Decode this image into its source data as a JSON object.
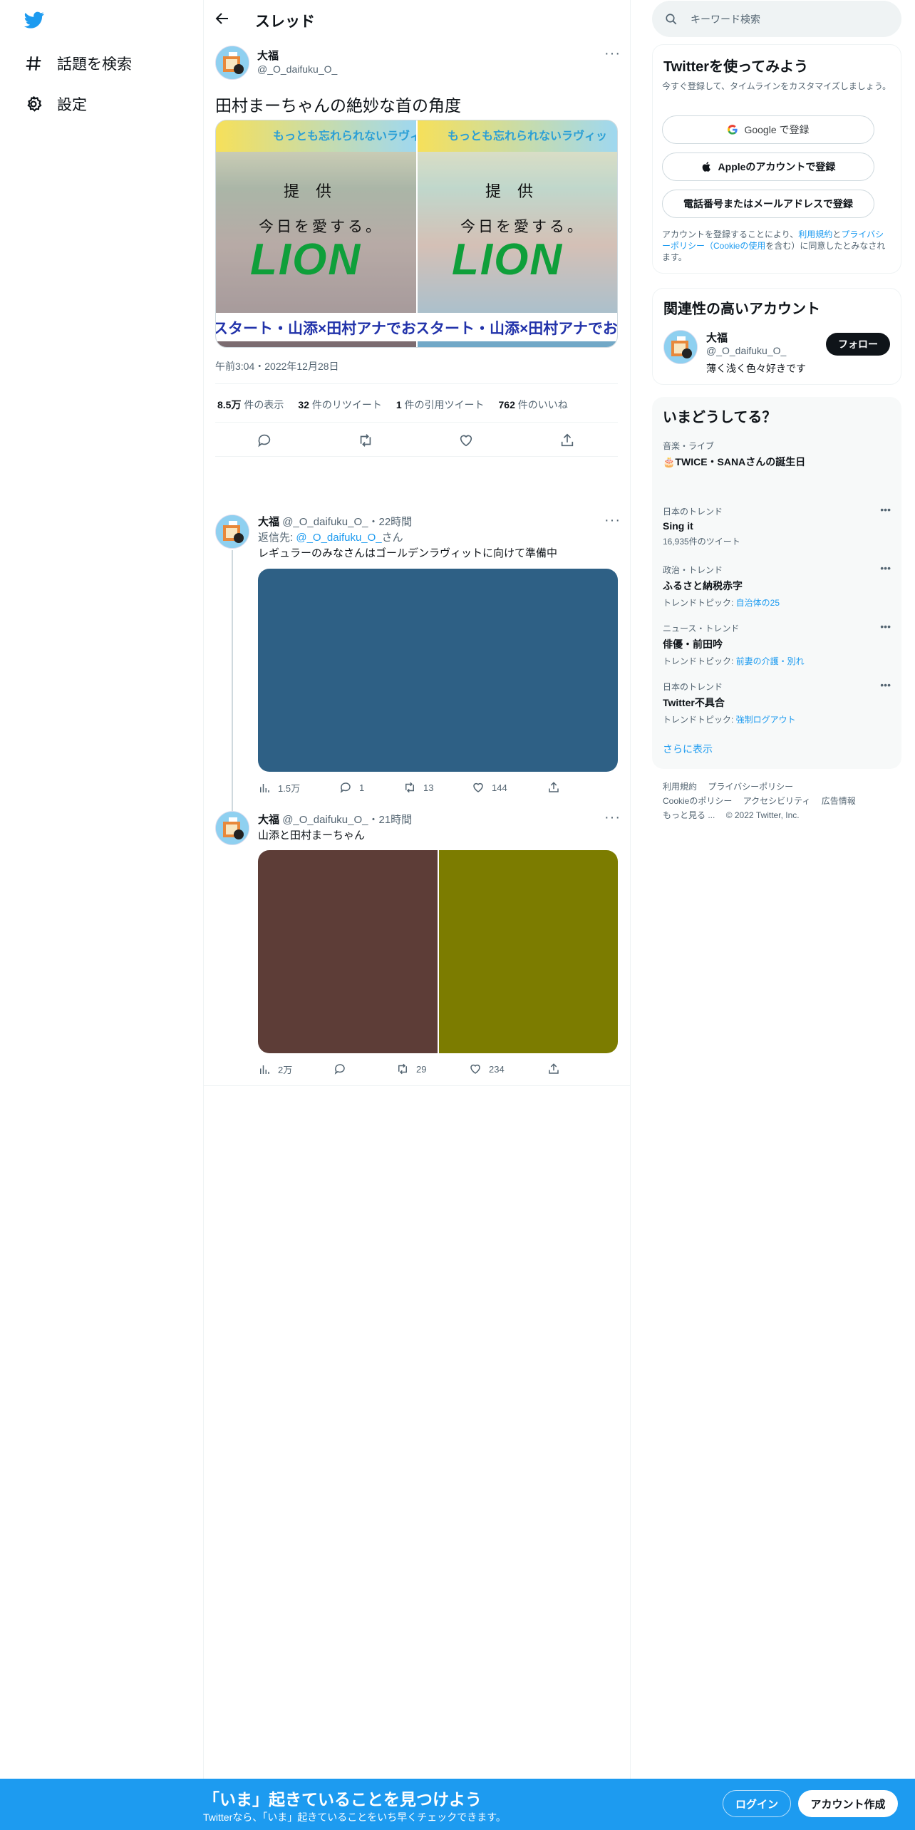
{
  "nav": {
    "explore_label": "話題を検索",
    "settings_label": "設定"
  },
  "header": {
    "title": "スレッド"
  },
  "main_tweet": {
    "author_name": "大福",
    "author_handle": "@_O_daifuku_O_",
    "text": "田村まーちゃんの絶妙な首の角度",
    "image_left": {
      "banner": "もっとも忘れられないラヴィッ",
      "sponsor_label": "提 供",
      "slogan": "今日を愛する。",
      "logo": "LION",
      "caption": "スタート・山添×田村アナでお"
    },
    "image_right": {
      "banner": "もっとも忘れられないラヴィッ",
      "sponsor_label": "提 供",
      "slogan": "今日を愛する。",
      "logo": "LION",
      "caption": "スタート・山添×田村アナでお"
    },
    "timestamp": "午前3:04・2022年12月28日",
    "stats": {
      "views_num": "8.5万",
      "views_label": "件の表示",
      "retweets_num": "32",
      "retweets_label": "件のリツイート",
      "quotes_num": "1",
      "quotes_label": "件の引用ツイート",
      "likes_num": "762",
      "likes_label": "件のいいね"
    }
  },
  "replies": [
    {
      "author_name": "大福",
      "author_meta": "@_O_daifuku_O_・22時間",
      "reply_to_prefix": "返信先: ",
      "reply_to_handle": "@_O_daifuku_O_",
      "reply_to_suffix": "さん",
      "text": "レギュラーのみなさんはゴールデンラヴィットに向けて準備中",
      "media_colors": [
        "#2e6085"
      ],
      "views": "1.5万",
      "replies": "1",
      "retweets": "13",
      "likes": "144"
    },
    {
      "author_name": "大福",
      "author_meta": "@_O_daifuku_O_・21時間",
      "text": "山添と田村まーちゃん",
      "media_colors": [
        "#5d3d37",
        "#7c7c00"
      ],
      "views": "2万",
      "replies": "",
      "retweets": "29",
      "likes": "234"
    }
  ],
  "search": {
    "placeholder": "キーワード検索"
  },
  "signup": {
    "title": "Twitterを使ってみよう",
    "subtitle": "今すぐ登録して、タイムラインをカスタマイズしましょう。",
    "google_label": "Google で登録",
    "apple_label": "Appleのアカウントで登録",
    "phone_label": "電話番号またはメールアドレスで登録",
    "terms_prefix": "アカウントを登録することにより、",
    "terms_link": "利用規約",
    "terms_and": "と",
    "privacy_link": "プライバシーポリシー（Cookieの使用",
    "terms_suffix": "を含む）に同意したとみなされます。"
  },
  "related": {
    "title": "関連性の高いアカウント",
    "name": "大福",
    "handle": "@_O_daifuku_O_",
    "bio": "薄く浅く色々好きです",
    "follow_label": "フォロー"
  },
  "trends": {
    "title": "いまどうしてる？",
    "music_category": "音楽・ライブ",
    "music_name": "🎂TWICE・SANAさんの誕生日",
    "items": [
      {
        "category": "日本のトレンド",
        "name": "Sing it",
        "sub": "16,935件のツイート",
        "sub_prefix": "",
        "sub_link": ""
      },
      {
        "category": "政治・トレンド",
        "name": "ふるさと納税赤字",
        "sub": "",
        "sub_prefix": "トレンドトピック: ",
        "sub_link": "自治体の25"
      },
      {
        "category": "ニュース・トレンド",
        "name": "俳優・前田吟",
        "sub": "",
        "sub_prefix": "トレンドトピック: ",
        "sub_link": "前妻の介護・別れ"
      },
      {
        "category": "日本のトレンド",
        "name": "Twitter不具合",
        "sub": "",
        "sub_prefix": "トレンドトピック: ",
        "sub_link": "強制ログアウト"
      }
    ],
    "show_more": "さらに表示"
  },
  "footer": {
    "terms": "利用規約",
    "privacy": "プライバシーポリシー",
    "cookie": "Cookieのポリシー",
    "accessibility": "アクセシビリティ",
    "ads": "広告情報",
    "more": "もっと見る ...",
    "copyright": "© 2022 Twitter, Inc."
  },
  "bottom_bar": {
    "title": "「いま」起きていることを見つけよう",
    "subtitle": "Twitterなら、「いま」起きていることをいち早くチェックできます。",
    "login_label": "ログイン",
    "signup_label": "アカウント作成"
  },
  "colors": {
    "accent": "#1d9bf0",
    "text": "#0f1419",
    "muted": "#536471",
    "lion_green": "#0f9f3a",
    "caption_pink": "#e62e8b",
    "caption_blue": "#2233aa"
  }
}
